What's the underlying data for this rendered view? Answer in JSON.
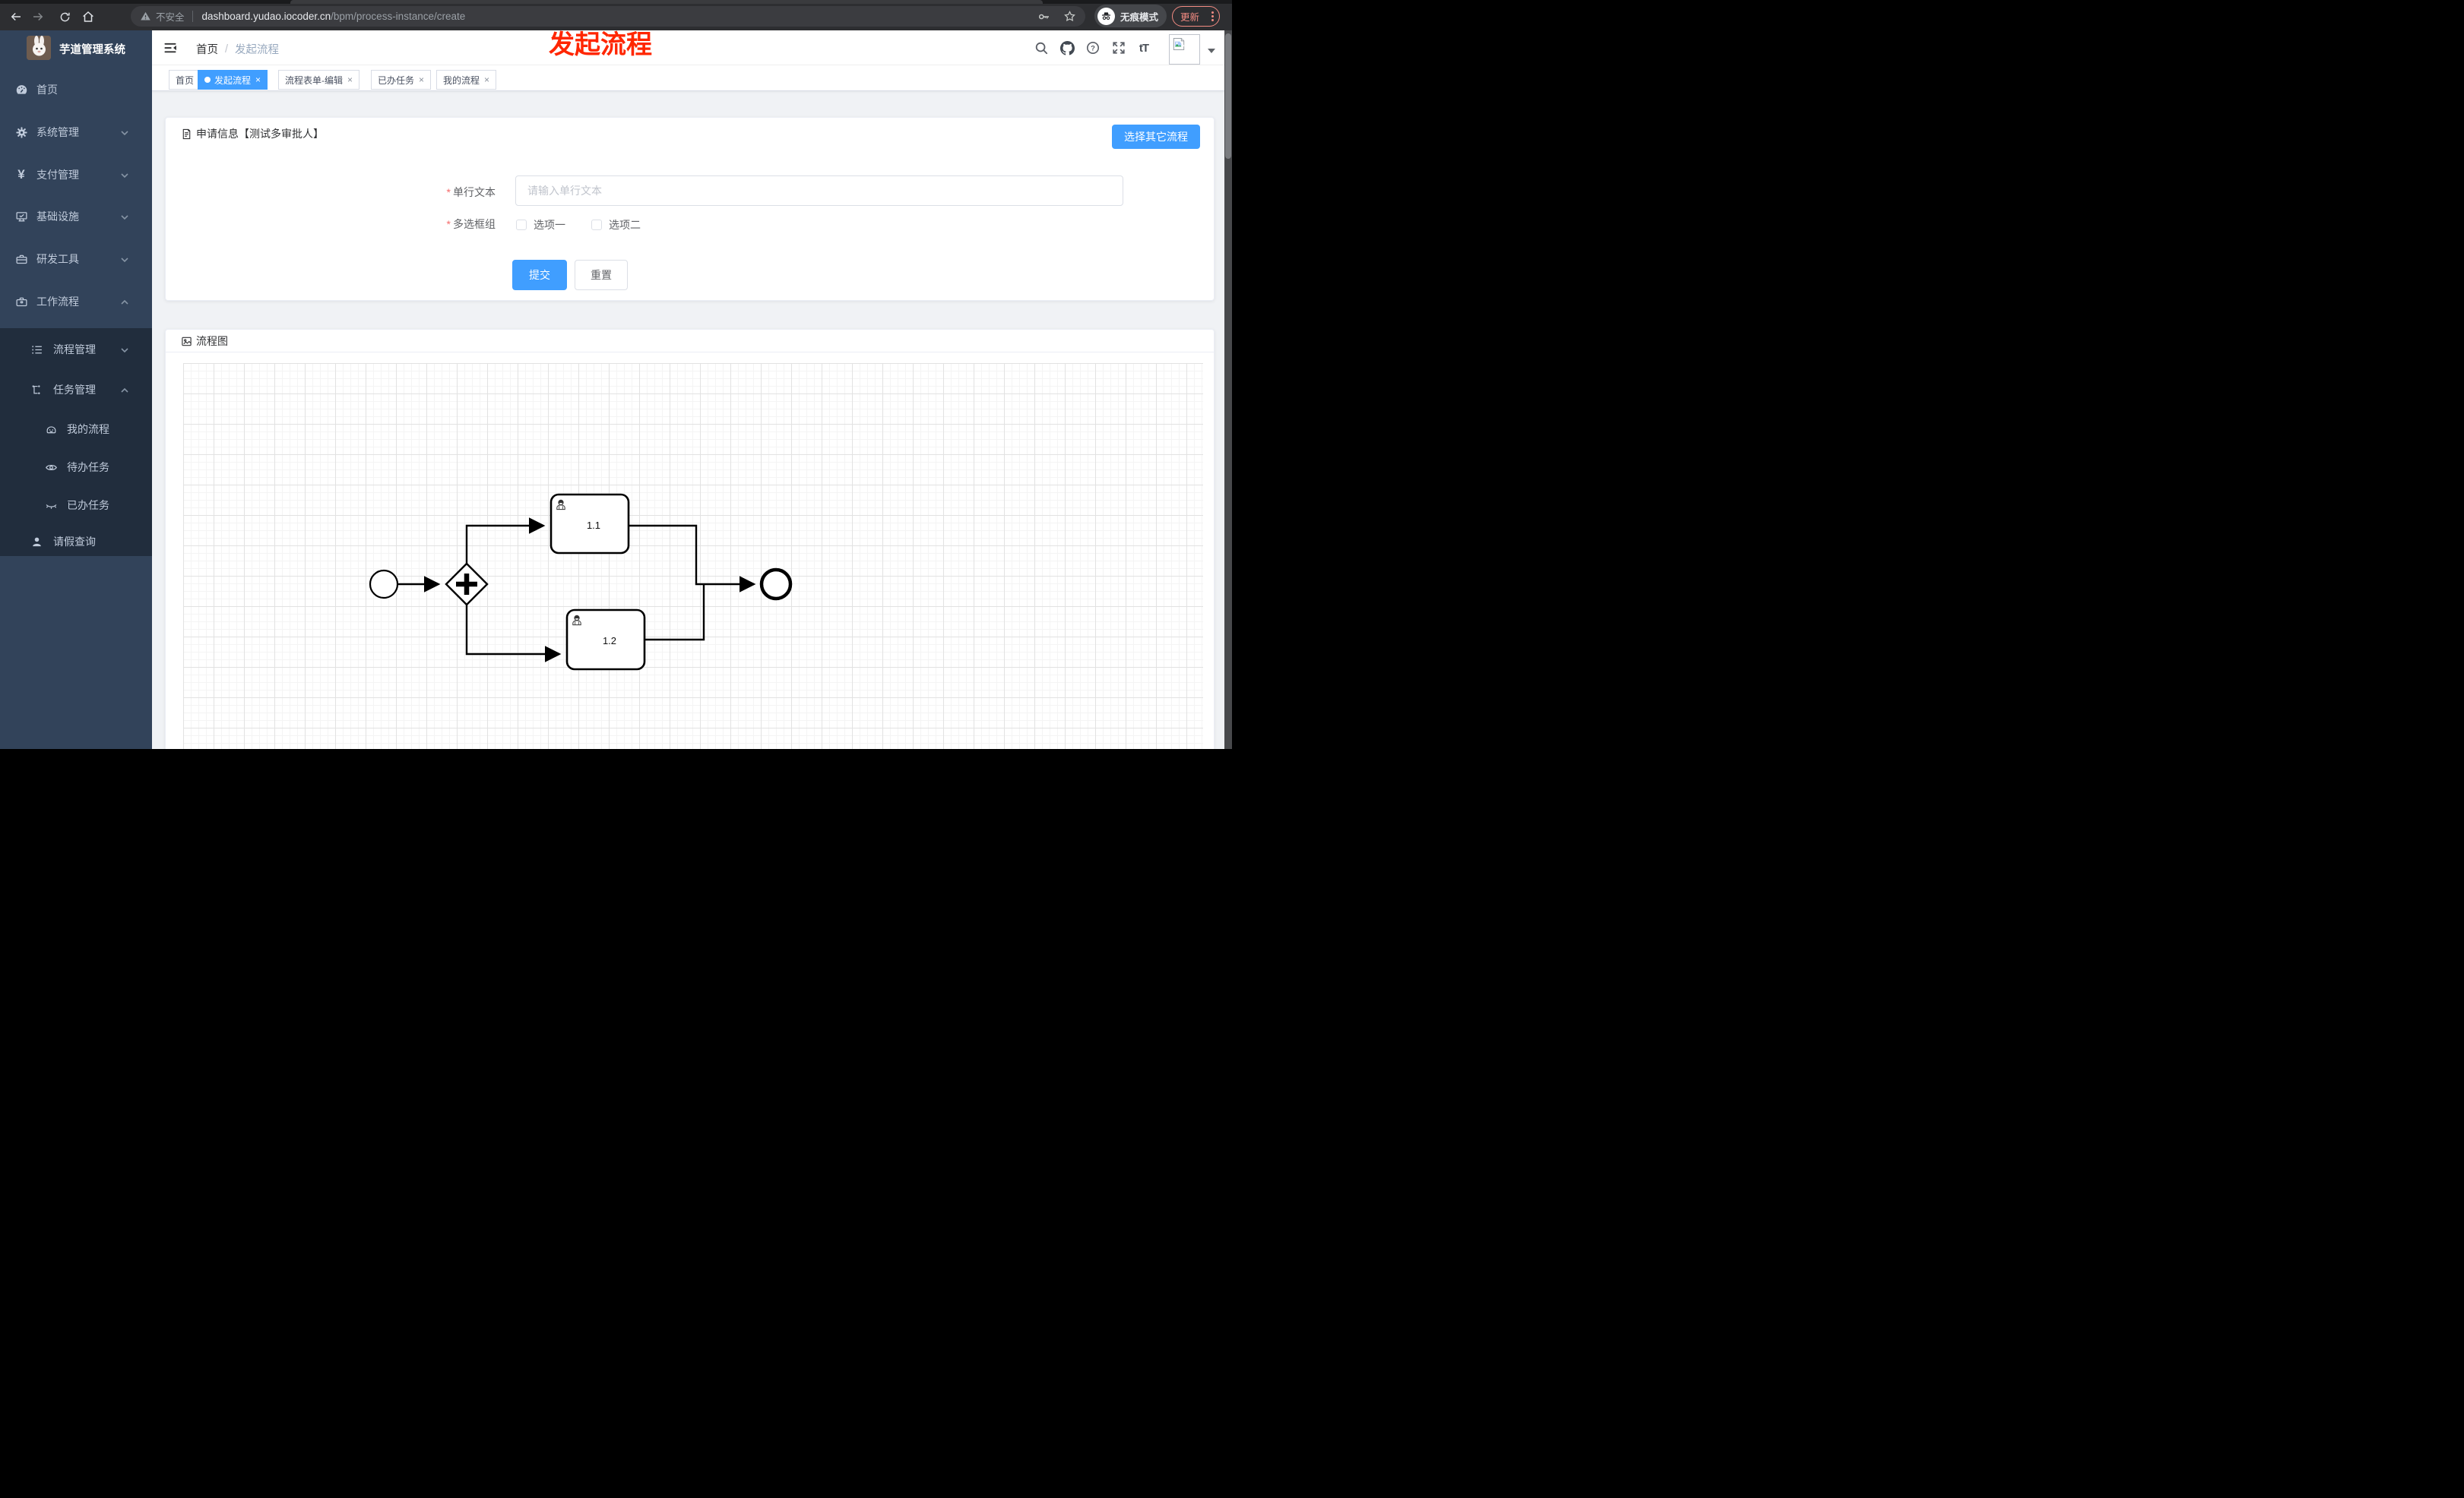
{
  "browser": {
    "security_label": "不安全",
    "url_host": "dashboard.yudao.iocoder.cn",
    "url_path": "/bpm/process-instance/create",
    "incognito_label": "无痕模式",
    "update_label": "更新"
  },
  "annotation": {
    "text": "发起流程",
    "color": "#ff2600"
  },
  "sidebar": {
    "logo_title": "芋道管理系统",
    "items": [
      {
        "label": "首页",
        "icon": "dashboard-icon"
      },
      {
        "label": "系统管理",
        "icon": "gear-icon",
        "chevron": "down"
      },
      {
        "label": "支付管理",
        "icon": "yen-icon",
        "icon_glyph": "¥",
        "chevron": "down"
      },
      {
        "label": "基础设施",
        "icon": "monitor-icon",
        "chevron": "down"
      },
      {
        "label": "研发工具",
        "icon": "toolbox-icon",
        "chevron": "down"
      },
      {
        "label": "工作流程",
        "icon": "briefcase-icon",
        "chevron": "up"
      },
      {
        "label": "流程管理",
        "icon": "flow-list-icon",
        "chevron": "down"
      },
      {
        "label": "任务管理",
        "icon": "task-tree-icon",
        "chevron": "up"
      },
      {
        "label": "我的流程",
        "icon": "my-process-icon"
      },
      {
        "label": "待办任务",
        "icon": "eye-icon"
      },
      {
        "label": "已办任务",
        "icon": "eye-off-icon"
      },
      {
        "label": "请假查询",
        "icon": "user-icon"
      }
    ]
  },
  "header": {
    "breadcrumb": {
      "home": "首页",
      "current": "发起流程",
      "separator": "/"
    },
    "font_icon_label": "tT"
  },
  "tabs": {
    "close_glyph": "×",
    "items": [
      {
        "label": "首页",
        "active": false,
        "closable": false
      },
      {
        "label": "发起流程",
        "active": true,
        "closable": true
      },
      {
        "label": "流程表单-编辑",
        "active": false,
        "closable": true
      },
      {
        "label": "已办任务",
        "active": false,
        "closable": true
      },
      {
        "label": "我的流程",
        "active": false,
        "closable": true
      }
    ]
  },
  "form_card": {
    "title": "申请信息【测试多审批人】",
    "choose_other_button": "选择其它流程",
    "required_mark": "*",
    "fields": [
      {
        "label": "单行文本",
        "required": true,
        "placeholder": "请输入单行文本",
        "value": ""
      },
      {
        "label": "多选框组",
        "required": true,
        "options": [
          "选项一",
          "选项二"
        ],
        "checked": [
          false,
          false
        ]
      }
    ],
    "submit_label": "提交",
    "reset_label": "重置"
  },
  "diagram_card": {
    "title": "流程图",
    "nodes": {
      "start": "start-event",
      "gateway": "parallel-gateway",
      "tasks": [
        {
          "label": "1.1",
          "type": "user-task"
        },
        {
          "label": "1.2",
          "type": "user-task"
        }
      ],
      "end": "end-event"
    }
  },
  "colors": {
    "accent": "#409eff",
    "annotation_red": "#ff2600",
    "sidebar_bg": "#32435a",
    "submenu_bg": "#212d3d"
  }
}
